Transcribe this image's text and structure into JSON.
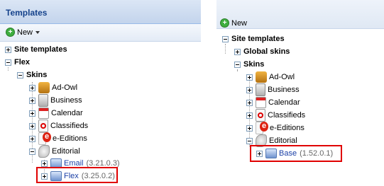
{
  "left": {
    "title": "Templates",
    "new_label": "New",
    "tree": [
      {
        "label": "Site templates",
        "bold": true
      },
      {
        "label": "Flex",
        "bold": true
      },
      {
        "label": "Skins",
        "bold": true
      },
      {
        "label": "Ad-Owl"
      },
      {
        "label": "Business"
      },
      {
        "label": "Calendar"
      },
      {
        "label": "Classifieds"
      },
      {
        "label": "e-Editions"
      },
      {
        "label": "Editorial"
      },
      {
        "label": "Email",
        "version": "(3.21.0.3)"
      },
      {
        "label": "Flex",
        "version": "(3.25.0.2)"
      }
    ]
  },
  "right": {
    "new_label": "New",
    "tree": [
      {
        "label": "Site templates",
        "bold": true
      },
      {
        "label": "Global skins",
        "bold": true
      },
      {
        "label": "Skins",
        "bold": true
      },
      {
        "label": "Ad-Owl"
      },
      {
        "label": "Business"
      },
      {
        "label": "Calendar"
      },
      {
        "label": "Classifieds"
      },
      {
        "label": "e-Editions"
      },
      {
        "label": "Editorial"
      },
      {
        "label": "Base",
        "version": "(1.52.0.1)"
      }
    ]
  },
  "colors": {
    "highlight": "#e00000",
    "title": "#15428b",
    "link": "#1a3fa6"
  }
}
